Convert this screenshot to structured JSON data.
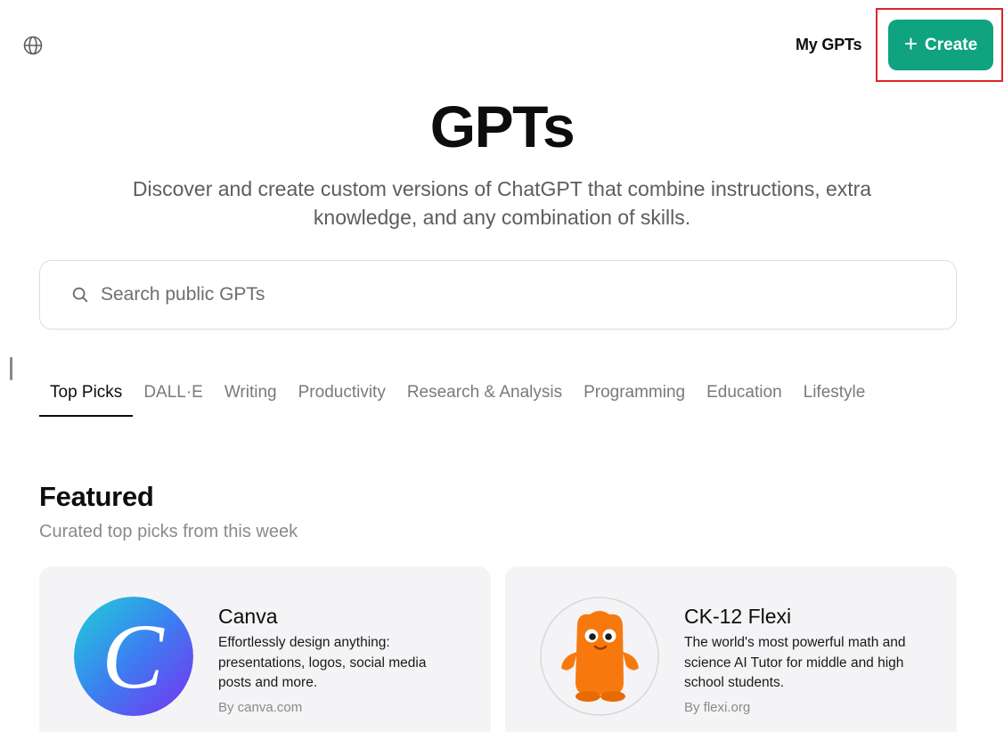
{
  "header": {
    "globe_icon": "globe-icon",
    "my_gpts_label": "My GPTs",
    "create_label": "Create",
    "create_icon": "plus-icon",
    "accent_color": "#10a37f",
    "highlight_color": "#d9262a"
  },
  "hero": {
    "title": "GPTs",
    "subtitle": "Discover and create custom versions of ChatGPT that combine instructions, extra knowledge, and any combination of skills."
  },
  "search": {
    "icon": "search-icon",
    "placeholder": "Search public GPTs",
    "value": ""
  },
  "tabs": [
    {
      "label": "Top Picks",
      "active": true
    },
    {
      "label": "DALL·E",
      "active": false
    },
    {
      "label": "Writing",
      "active": false
    },
    {
      "label": "Productivity",
      "active": false
    },
    {
      "label": "Research & Analysis",
      "active": false
    },
    {
      "label": "Programming",
      "active": false
    },
    {
      "label": "Education",
      "active": false
    },
    {
      "label": "Lifestyle",
      "active": false
    }
  ],
  "featured": {
    "title": "Featured",
    "subtitle": "Curated top picks from this week",
    "cards": [
      {
        "name": "Canva",
        "description": "Effortlessly design anything: presentations, logos, social media posts and more.",
        "by": "By canva.com",
        "logo": "canva-logo"
      },
      {
        "name": "CK-12 Flexi",
        "description": "The world's most powerful math and science AI Tutor for middle and high school students.",
        "by": "By flexi.org",
        "logo": "flexi-logo"
      }
    ]
  }
}
